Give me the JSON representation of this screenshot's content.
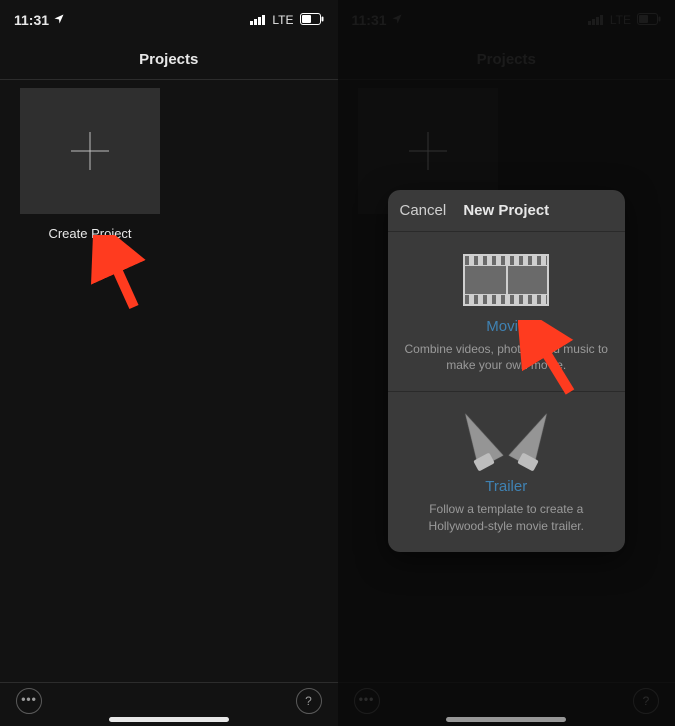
{
  "status_bar": {
    "time": "11:31",
    "location_icon": "location-arrow-icon",
    "network_label": "LTE",
    "signal_icon": "cellular-signal-icon",
    "battery_icon": "battery-half-icon"
  },
  "header": {
    "title": "Projects"
  },
  "create_project": {
    "label": "Create Project",
    "icon": "plus-icon"
  },
  "bottom_toolbar": {
    "more_icon": "more-horizontal-icon",
    "help_icon": "help-circle-icon",
    "help_glyph": "?"
  },
  "modal": {
    "cancel_label": "Cancel",
    "title": "New Project",
    "options": [
      {
        "icon": "filmstrip-icon",
        "title": "Movie",
        "desc": "Combine videos, photos, and music to make your own movie."
      },
      {
        "icon": "spotlights-icon",
        "title": "Trailer",
        "desc": "Follow a template to create a Hollywood-style movie trailer."
      }
    ]
  },
  "annotations": {
    "arrow_color": "#ff3b1f"
  }
}
